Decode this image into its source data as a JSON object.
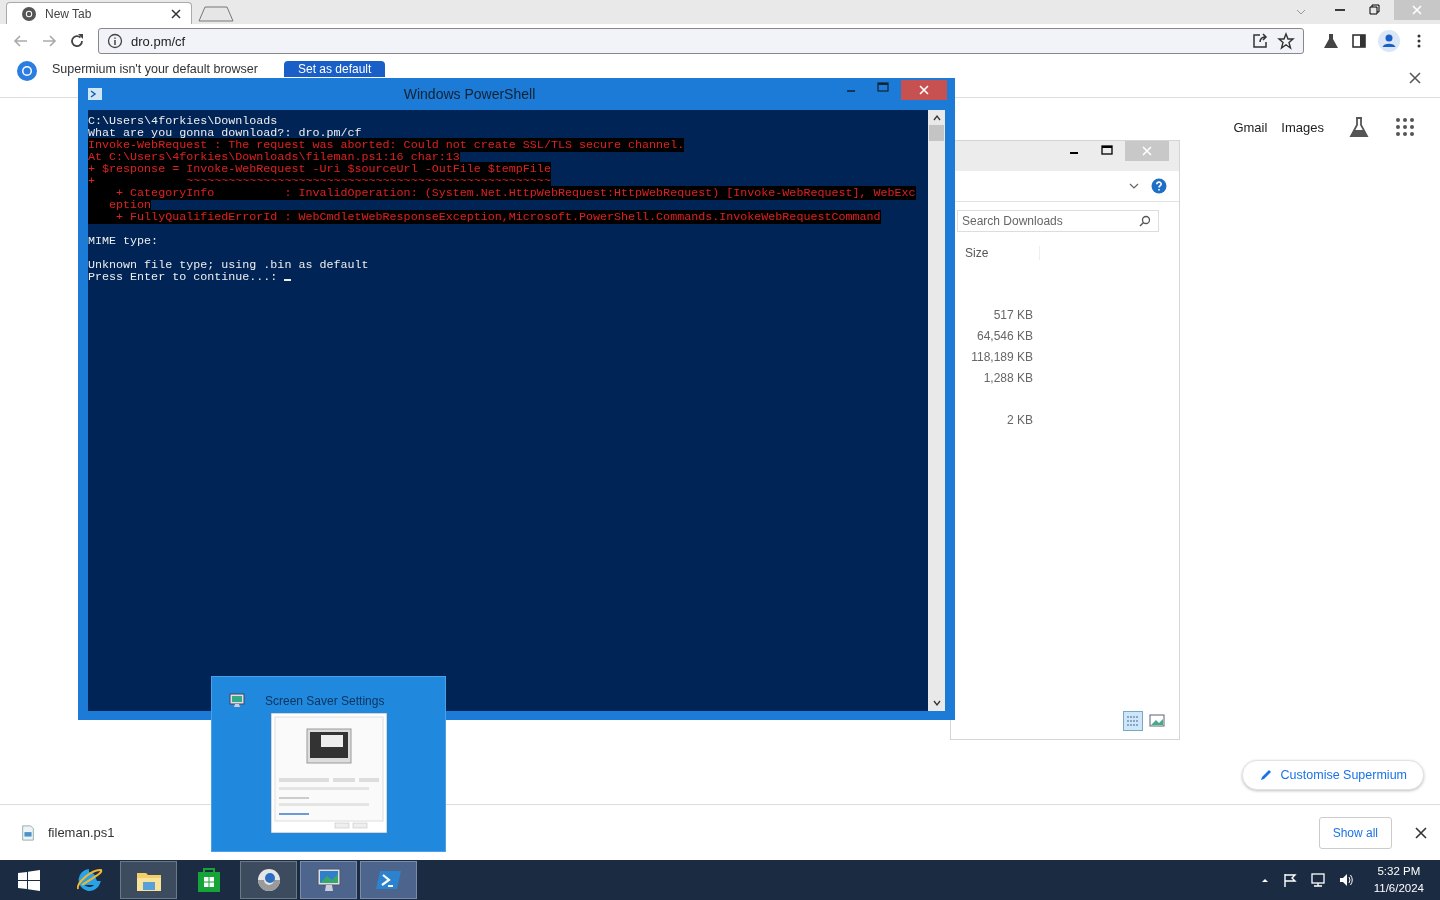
{
  "browser": {
    "tab": {
      "title": "New Tab",
      "selected": true
    },
    "address": "dro.pm/cf",
    "infobar": {
      "message": "Supermium isn't your default browser",
      "button": "Set as default"
    },
    "links": [
      "Gmail",
      "Images"
    ],
    "customise_button": "Customise Supermium",
    "download": {
      "file": "fileman.ps1",
      "show_all": "Show all"
    }
  },
  "powershell": {
    "title": "Windows PowerShell",
    "lines": [
      {
        "kind": "normal",
        "text": "C:\\Users\\4forkies\\Downloads"
      },
      {
        "kind": "normal",
        "text": "What are you gonna download?: dro.pm/cf"
      },
      {
        "kind": "error",
        "text": "Invoke-WebRequest : The request was aborted: Could not create SSL/TLS secure channel."
      },
      {
        "kind": "error",
        "text": "At C:\\Users\\4forkies\\Downloads\\fileman.ps1:16 char:13"
      },
      {
        "kind": "error",
        "text": "+ $response = Invoke-WebRequest -Uri $sourceUrl -OutFile $tempFile"
      },
      {
        "kind": "error",
        "text": "+             ~~~~~~~~~~~~~~~~~~~~~~~~~~~~~~~~~~~~~~~~~~~~~~~~~~~~"
      },
      {
        "kind": "error",
        "text": "    + CategoryInfo          : InvalidOperation: (System.Net.HttpWebRequest:HttpWebRequest) [Invoke-WebRequest], WebExc"
      },
      {
        "kind": "error",
        "text": "   eption"
      },
      {
        "kind": "error",
        "text": "    + FullyQualifiedErrorId : WebCmdletWebResponseException,Microsoft.PowerShell.Commands.InvokeWebRequestCommand"
      },
      {
        "kind": "blank"
      },
      {
        "kind": "normal",
        "text": "MIME type:"
      },
      {
        "kind": "blank"
      },
      {
        "kind": "normal",
        "text": "Unknown file type; using .bin as default"
      },
      {
        "kind": "prompt",
        "text": "Press Enter to continue...: "
      }
    ]
  },
  "explorer": {
    "search_placeholder": "Search Downloads",
    "column": "Size",
    "rows": [
      {
        "kind": "size",
        "size": "517 KB"
      },
      {
        "kind": "size",
        "size": "64,546 KB"
      },
      {
        "kind": "size",
        "size": "118,189 KB"
      },
      {
        "kind": "size",
        "size": "1,288 KB"
      },
      {
        "kind": "blank"
      },
      {
        "kind": "size",
        "size": "2 KB"
      }
    ]
  },
  "thumbnail": {
    "title": "Screen Saver Settings"
  },
  "taskbar": {
    "items": [
      {
        "kind": "start",
        "running": false,
        "active": false
      },
      {
        "kind": "ie",
        "running": false,
        "active": false
      },
      {
        "kind": "explorer",
        "running": true,
        "active": false
      },
      {
        "kind": "store",
        "running": false,
        "active": false
      },
      {
        "kind": "browser",
        "running": true,
        "active": false
      },
      {
        "kind": "screensaver",
        "running": true,
        "active": true
      },
      {
        "kind": "powershell",
        "running": true,
        "active": true
      }
    ],
    "time": "5:32 PM",
    "date": "11/6/2024"
  }
}
